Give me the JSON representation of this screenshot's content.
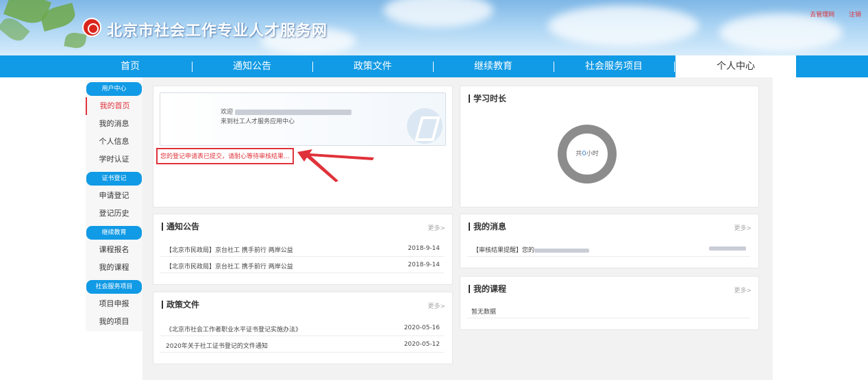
{
  "header": {
    "site_title": "北京市社会工作专业人才服务网",
    "admin_link": "去管理网",
    "logout_link": "注销"
  },
  "nav": {
    "items": [
      "首页",
      "通知公告",
      "政策文件",
      "继续教育",
      "社会服务项目",
      "个人中心"
    ],
    "active": "个人中心",
    "separator": "|"
  },
  "sidebar": {
    "groups": [
      {
        "heading": "用户中心",
        "items": [
          "我的首页",
          "我的消息",
          "个人信息",
          "学时认证"
        ]
      },
      {
        "heading": "证书登记",
        "items": [
          "申请登记",
          "登记历史"
        ]
      },
      {
        "heading": "继续教育",
        "items": [
          "课程报名",
          "我的课程"
        ]
      },
      {
        "heading": "社会服务项目",
        "items": [
          "项目申报",
          "我的项目"
        ]
      }
    ],
    "active_item": "我的首页"
  },
  "welcome": {
    "greeting_prefix": "欢迎",
    "subtitle": "来到社工人才服务应用中心",
    "pending_message": "您的登记申请表已提交，请耐心等待审核结果..."
  },
  "study_hours": {
    "title": "学习时长",
    "label_prefix": "共",
    "value": "0",
    "label_suffix": "小时"
  },
  "notices": {
    "title": "通知公告",
    "more": "更多>",
    "rows": [
      {
        "title": "【北京市民政局】京台社工 携手前行 两岸公益",
        "date": "2018-9-14"
      },
      {
        "title": "【北京市民政局】京台社工 携手前行 两岸公益",
        "date": "2018-9-14"
      }
    ]
  },
  "policies": {
    "title": "政策文件",
    "more": "更多>",
    "rows": [
      {
        "title": "《北京市社会工作者职业水平证书登记实施办法》",
        "date": "2020-05-16"
      },
      {
        "title": "2020年关于社工证书登记的文件通知",
        "date": "2020-05-12"
      }
    ]
  },
  "messages": {
    "title": "我的消息",
    "more": "更多>",
    "rows": [
      {
        "title_prefix": "【审核结果提醒】您的"
      }
    ]
  },
  "courses": {
    "title": "我的课程",
    "more": "更多>",
    "empty_text": "暂无数据"
  },
  "colors": {
    "nav_blue": "#119ae5",
    "alert_red": "#e0323a",
    "donut_gray": "#8c8c8c"
  }
}
